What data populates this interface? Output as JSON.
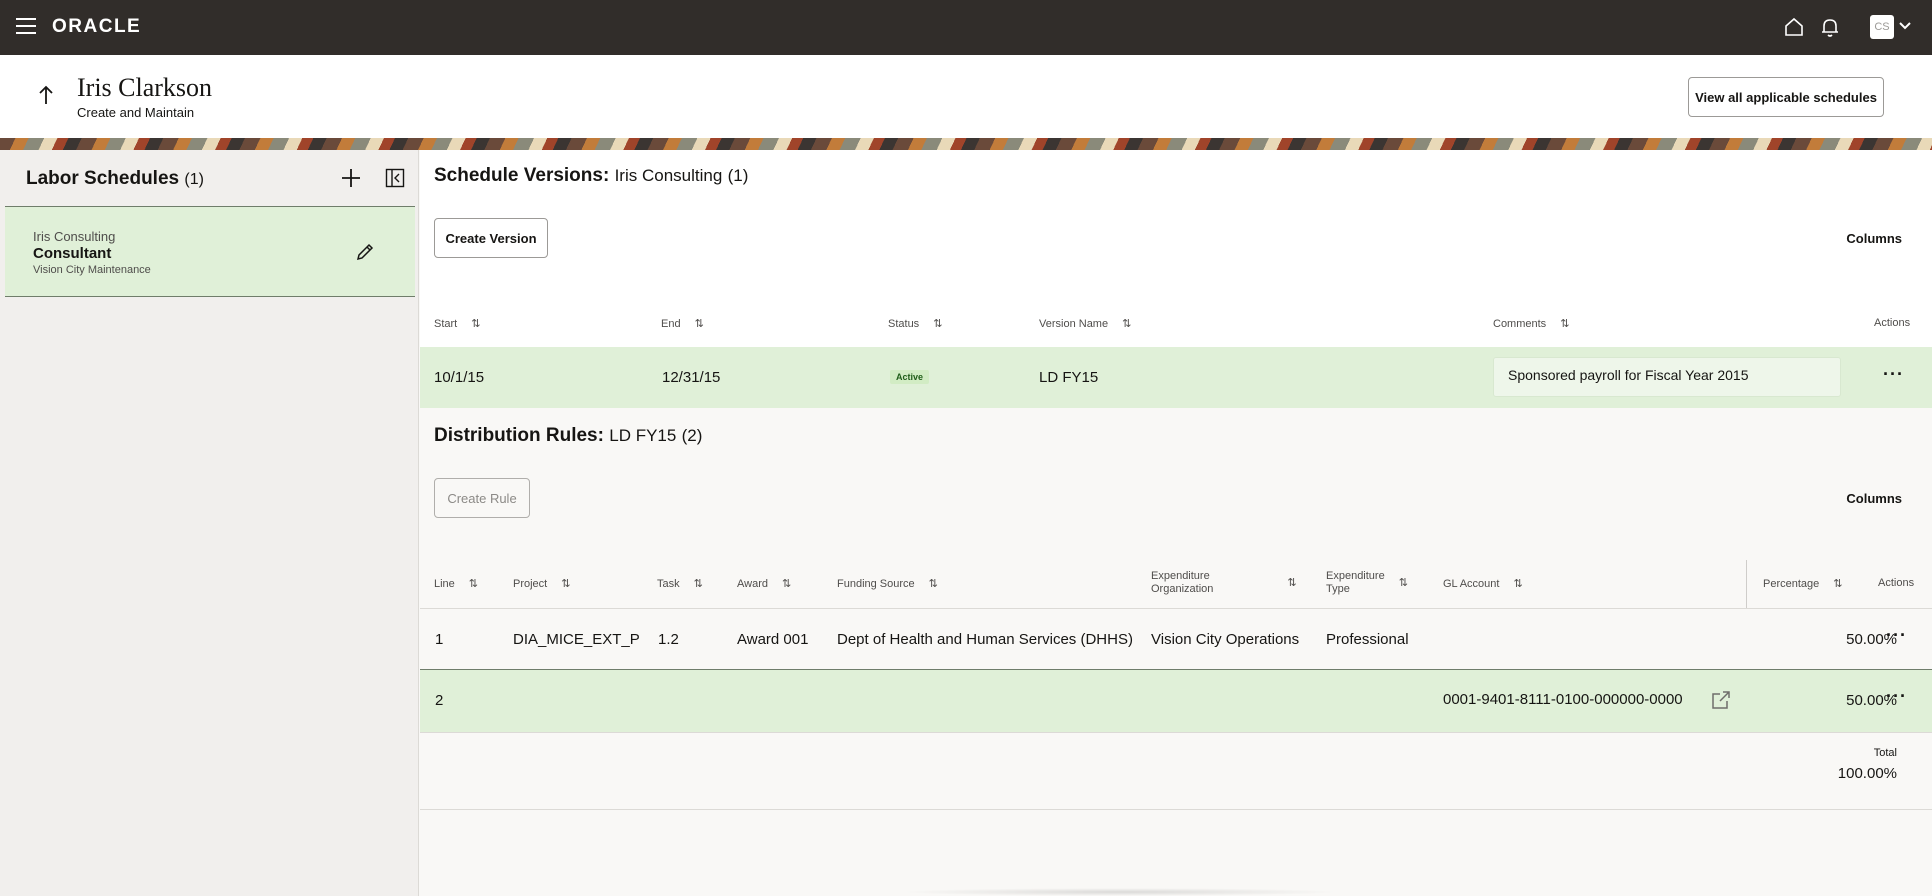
{
  "topbar": {
    "logo": "ORACLE",
    "avatar_initials": "CS",
    "icons": [
      "hamburger-icon",
      "home-icon",
      "bell-icon",
      "chevron-down-icon"
    ]
  },
  "header": {
    "name": "Iris Clarkson",
    "subtitle": "Create and Maintain",
    "view_all_label": "View all applicable schedules"
  },
  "labor_schedules": {
    "title": "Labor Schedules",
    "count": "(1)",
    "item": {
      "org": "Iris Consulting",
      "role": "Consultant",
      "location": "Vision City Maintenance"
    }
  },
  "schedule_versions": {
    "title": "Schedule Versions:",
    "context": "Iris Consulting",
    "count": "(1)",
    "create_label": "Create Version",
    "columns_label": "Columns",
    "headers": {
      "start": "Start",
      "end": "End",
      "status": "Status",
      "version_name": "Version Name",
      "comments": "Comments",
      "actions": "Actions"
    },
    "row": {
      "start": "10/1/15",
      "end": "12/31/15",
      "status": "Active",
      "version_name": "LD FY15",
      "comments": "Sponsored payroll for Fiscal Year 2015",
      "actions": "···"
    }
  },
  "distribution_rules": {
    "title": "Distribution Rules:",
    "context": "LD FY15",
    "count": "(2)",
    "create_label": "Create Rule",
    "columns_label": "Columns",
    "headers": {
      "line": "Line",
      "project": "Project",
      "task": "Task",
      "award": "Award",
      "funding_source": "Funding Source",
      "exp_org_1": "Expenditure",
      "exp_org_2": "Organization",
      "exp_type_1": "Expenditure",
      "exp_type_2": "Type",
      "gl_account": "GL Account",
      "percentage": "Percentage",
      "actions": "Actions"
    },
    "rows": [
      {
        "line": "1",
        "project": "DIA_MICE_EXT_P",
        "task": "1.2",
        "award": "Award 001",
        "funding_source": "Dept of Health and Human Services (DHHS)",
        "exp_org": "Vision City Operations",
        "exp_type": "Professional",
        "gl_account": "",
        "percentage": "50.00%",
        "actions": "···"
      },
      {
        "line": "2",
        "project": "",
        "task": "",
        "award": "",
        "funding_source": "",
        "exp_org": "",
        "exp_type": "",
        "gl_account": "0001-9401-8111-0100-000000-0000",
        "percentage": "50.00%",
        "actions": "···"
      }
    ],
    "total_label": "Total",
    "total_value": "100.00%"
  },
  "colors": {
    "topbar": "#312d2a",
    "selected_row": "#e0f0d8",
    "active_badge": "#1f5d18"
  }
}
